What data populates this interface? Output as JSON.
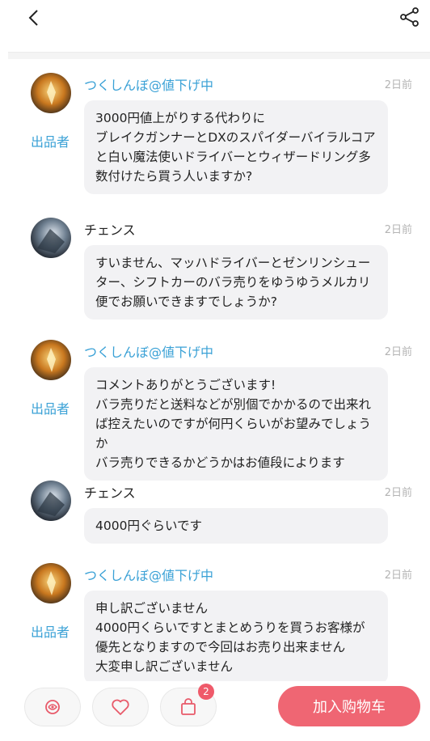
{
  "header": {
    "back_icon": "chevron-left-icon",
    "share_icon": "share-icon"
  },
  "comments": [
    {
      "author": "つくしんぼ@値下げ中",
      "role": "seller",
      "badge": "出品者",
      "time": "2日前",
      "text": "3000円値上がりする代わりに\nブレイクガンナーとDXのスパイダーバイラルコアと白い魔法使いドライバーとウィザードリング多数付けたら買う人いますか?"
    },
    {
      "author": "チェンス",
      "role": "buyer",
      "badge": "",
      "time": "2日前",
      "text": "すいません、マッハドライバーとゼンリンシューター、シフトカーのバラ売りをゆうゆうメルカリ便でお願いできますでしょうか?"
    },
    {
      "author": "つくしんぼ@値下げ中",
      "role": "seller",
      "badge": "出品者",
      "time": "2日前",
      "text": "コメントありがとうございます!\nバラ売りだと送料などが別個でかかるので出来れば控えたいのですが何円くらいがお望みでしょうか\nバラ売りできるかどうかはお値段によります"
    },
    {
      "author": "チェンス",
      "role": "buyer",
      "badge": "",
      "time": "2日前",
      "text": "4000円ぐらいです"
    },
    {
      "author": "つくしんぼ@値下げ中",
      "role": "seller",
      "badge": "出品者",
      "time": "2日前",
      "text": "申し訳ございません\n4000円くらいですとまとめうりを買うお客様が優先となりますので今回はお売り出来ません\n大変申し訳ございません"
    }
  ],
  "bottom_bar": {
    "shop_icon": "shop-icon",
    "favorite_icon": "heart-icon",
    "bag_icon": "shopping-bag-icon",
    "bag_count": "2",
    "add_to_cart_label": "加入购物车",
    "accent_color": "#ef6673"
  }
}
